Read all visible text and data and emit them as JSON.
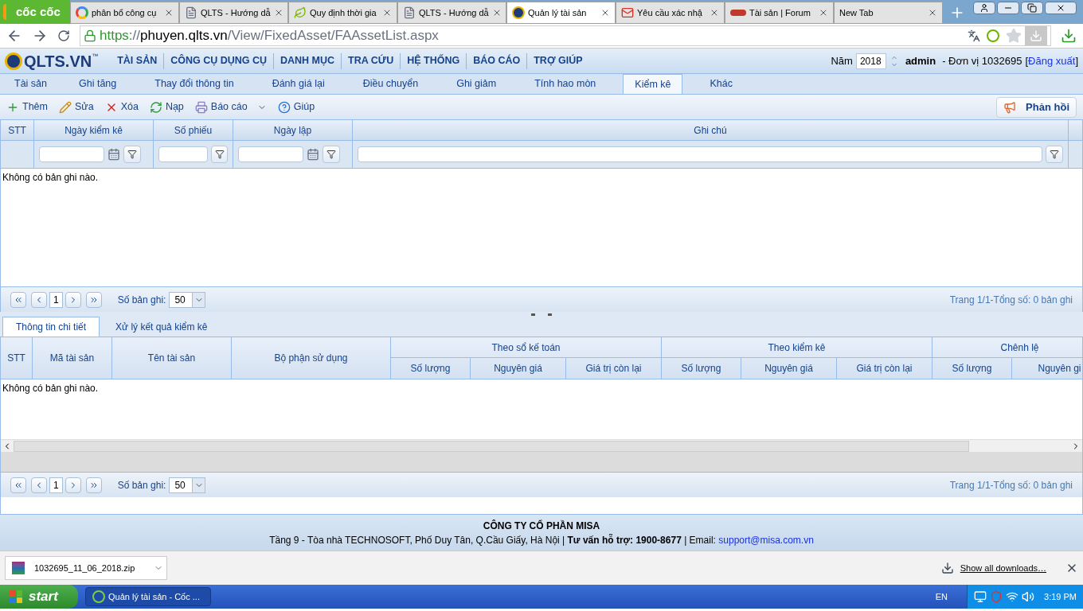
{
  "browser": {
    "brand": "cốc cốc",
    "tabs": [
      {
        "title": "phân bổ công cụ",
        "kind": "google",
        "selected": false
      },
      {
        "title": "QLTS - Hướng dẫ",
        "kind": "page",
        "selected": false
      },
      {
        "title": "Quy định thời gia",
        "kind": "leaf",
        "selected": false
      },
      {
        "title": "QLTS - Hướng dẫ",
        "kind": "page",
        "selected": false
      },
      {
        "title": "Quản lý tài sản",
        "kind": "qlts",
        "selected": true
      },
      {
        "title": "Yêu cầu xác nhậ",
        "kind": "mail",
        "selected": false
      },
      {
        "title": "Tài sản | Forum",
        "kind": "misa",
        "selected": false
      },
      {
        "title": "New Tab",
        "kind": "blank",
        "selected": false
      }
    ],
    "url": [
      {
        "kind": "scheme",
        "text": "https"
      },
      {
        "kind": "sep",
        "text": "://"
      },
      {
        "kind": "host",
        "text": "phuyen.qlts.vn"
      },
      {
        "kind": "path",
        "text": "/View/FixedAsset/FAAssetList.aspx"
      }
    ]
  },
  "app": {
    "logo": "QLTS.VN",
    "logo_mark": "™",
    "menu": [
      "TÀI SẢN",
      "CÔNG CỤ DỤNG CỤ",
      "DANH MỤC",
      "TRA CỨU",
      "HỆ THỐNG",
      "BÁO CÁO",
      "TRỢ GIÚP"
    ],
    "year_label": "Năm",
    "year": "2018",
    "user": "admin",
    "unit": "- Đơn vị 1032695",
    "bracket_open": "[",
    "logout": "Đăng xuất",
    "bracket_close": "]",
    "subtabs": [
      {
        "label": "Tài sản",
        "selected": false
      },
      {
        "label": "Ghi tăng",
        "selected": false
      },
      {
        "label": "Thay đổi thông tin",
        "selected": false
      },
      {
        "label": "Đánh giá lại",
        "selected": false
      },
      {
        "label": "Điều chuyển",
        "selected": false
      },
      {
        "label": "Ghi giảm",
        "selected": false
      },
      {
        "label": "Tính hao mòn",
        "selected": false
      },
      {
        "label": "Kiểm kê",
        "selected": true
      },
      {
        "label": "Khác",
        "selected": false
      }
    ],
    "toolbar": [
      {
        "label": "Thêm",
        "kind": "add",
        "dropdown": false
      },
      {
        "label": "Sửa",
        "kind": "edit",
        "dropdown": false
      },
      {
        "label": "Xóa",
        "kind": "delete",
        "dropdown": false
      },
      {
        "label": "Nạp",
        "kind": "reload",
        "dropdown": false
      },
      {
        "label": "Báo cáo",
        "kind": "report",
        "dropdown": true
      },
      {
        "label": "Giúp",
        "kind": "help",
        "dropdown": false
      }
    ],
    "feedback": "Phản hồi"
  },
  "main_grid": {
    "columns": [
      {
        "label": "STT",
        "kind": "plain"
      },
      {
        "label": "Ngày kiểm kê",
        "kind": "date"
      },
      {
        "label": "Số phiếu",
        "kind": "text"
      },
      {
        "label": "Ngày lập",
        "kind": "date"
      },
      {
        "label": "Ghi chú",
        "kind": "wide"
      }
    ],
    "empty": "Không có bản ghi nào.",
    "pager": {
      "page": "1",
      "size_label": "Số bản ghi:",
      "size": "50",
      "summary": "Trang 1/1-Tổng số: 0 bản ghi"
    }
  },
  "detail_tabs": [
    {
      "label": "Thông tin chi tiết",
      "selected": true
    },
    {
      "label": "Xử lý kết quả kiểm kê",
      "selected": false
    }
  ],
  "detail_grid": {
    "columns": [
      "STT",
      "Mã tài sản",
      "Tên tài sản",
      "Bộ phận sử dụng"
    ],
    "groups": [
      {
        "label": "Theo sổ kế toán",
        "columns": [
          "Số lượng",
          "Nguyên giá",
          "Giá trị còn lại"
        ]
      },
      {
        "label": "Theo kiểm kê",
        "columns": [
          "Số lượng",
          "Nguyên giá",
          "Giá trị còn lại"
        ]
      },
      {
        "label": "Chênh lệ",
        "columns": [
          "Số lượng",
          "Nguyên gi"
        ]
      }
    ],
    "empty": "Không có bản ghi nào.",
    "pager": {
      "page": "1",
      "size_label": "Số bản ghi:",
      "size": "50",
      "summary": "Trang 1/1-Tổng số: 0 bản ghi"
    }
  },
  "footer": {
    "company": "CÔNG TY CỔ PHẦN MISA",
    "address": "Tầng 9 - Tòa nhà TECHNOSOFT, Phố Duy Tân, Q.Cầu Giấy, Hà Nội | **Tư vấn hỗ trợ: 1900-8677** | Email: ",
    "email": "support@misa.com.vn"
  },
  "downloads": {
    "file": "1032695_11_06_2018.zip",
    "show_all": "Show all downloads…"
  },
  "taskbar": {
    "start": "start",
    "window": "Quản lý tài sản - Cốc ...",
    "language": "EN",
    "time": "3:19 PM"
  }
}
